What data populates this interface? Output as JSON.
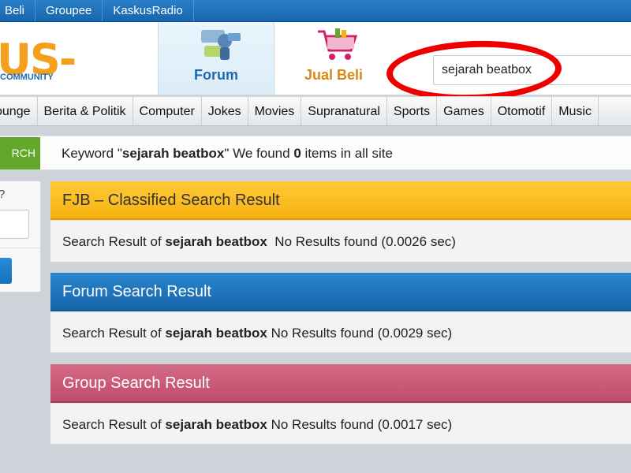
{
  "topbar": {
    "links": [
      "Beli",
      "Groupee",
      "KaskusRadio"
    ]
  },
  "header": {
    "logo_text": "US-",
    "logo_sub": "COMMUNITY",
    "tabs": [
      {
        "label": "Forum",
        "icon": "forum-icon"
      },
      {
        "label": "Jual Beli",
        "icon": "shopping-cart-icon"
      }
    ],
    "search_value": "sejarah beatbox"
  },
  "categories": [
    "ounge",
    "Berita & Politik",
    "Computer",
    "Jokes",
    "Movies",
    "Supranatural",
    "Sports",
    "Games",
    "Otomotif",
    "Music"
  ],
  "keyword_bar": {
    "tag": "RCH",
    "prefix": "Keyword \"",
    "keyword": "sejarah beatbox",
    "middle": "\" We found ",
    "count": "0",
    "suffix": " items in all site"
  },
  "sidebar": {
    "symbol": "?"
  },
  "panels": [
    {
      "title": "FJB – Classified Search Result",
      "prefix": "Search Result of ",
      "keyword": "sejarah beatbox",
      "result": "  No Results found (0.0026 sec)"
    },
    {
      "title": "Forum Search Result",
      "prefix": "Search Result of ",
      "keyword": "sejarah beatbox",
      "result": " No Results found (0.0029 sec)"
    },
    {
      "title": "Group Search Result",
      "prefix": "Search Result of ",
      "keyword": "sejarah beatbox",
      "result": " No Results found (0.0017 sec)"
    }
  ],
  "colors": {
    "topbar": "#1b6ab3",
    "fjb_header": "#f6b20f",
    "forum_header": "#1766ad",
    "group_header": "#c95a78",
    "search_tag": "#63a82a",
    "annotation": "#ee0000"
  }
}
